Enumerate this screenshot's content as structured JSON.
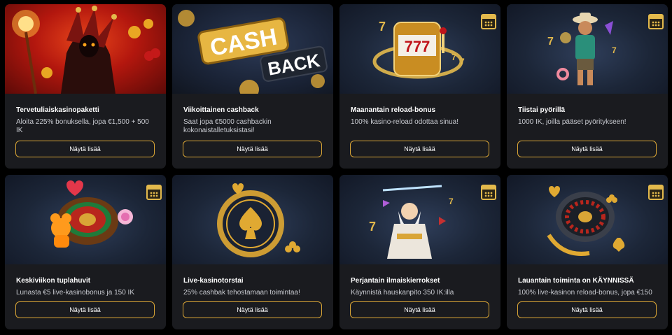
{
  "cards": [
    {
      "title": "Tervetuliaiskasinopaketti",
      "desc": "Aloita 225% bonuksella, jopa €1,500 + 500 IK",
      "button": "Näytä lisää",
      "art": "jester-wizard-image"
    },
    {
      "title": "Viikoittainen cashback",
      "desc": "Saat jopa €5000 cashbackin kokonaistalletuksistasi!",
      "button": "Näytä lisää",
      "art": "cashback-image",
      "art_text": [
        "CASH",
        "BACK"
      ]
    },
    {
      "title": "Maanantain reload-bonus",
      "desc": "100% kasino-reload odottaa sinua!",
      "button": "Näytä lisää",
      "art": "slot-machine-777-image",
      "art_text": [
        "777"
      ]
    },
    {
      "title": "Tiistai pyörillä",
      "desc": "1000 IK, joilla pääset pyöritykseen!",
      "button": "Näytä lisää",
      "art": "cowboy-character-image"
    },
    {
      "title": "Keskiviikon tuplahuvit",
      "desc": "Lunasta €5 live-kasinobonus ja 150 IK",
      "button": "Näytä lisää",
      "art": "roulette-gummy-bear-image"
    },
    {
      "title": "Live-kasinotorstai",
      "desc": "25% cashbak tehostamaan toimintaa!",
      "button": "Näytä lisää",
      "art": "poker-chip-spade-image"
    },
    {
      "title": "Perjantain ilmaiskierrokset",
      "desc": "Käynnistä hauskanpito 350 IK:illa",
      "button": "Näytä lisää",
      "art": "zeus-image"
    },
    {
      "title": "Lauantain toiminta on KÄYNNISSÄ",
      "desc": "100% live-kasinon reload-bonus, jopa €150",
      "button": "Näytä lisää",
      "art": "roulette-wheel-image"
    }
  ],
  "colors": {
    "card_bg": "#1a1b1f",
    "accent_gold": "#d9a536",
    "page_bg": "#000000"
  },
  "icons": {
    "calendar": "calendar-icon"
  }
}
